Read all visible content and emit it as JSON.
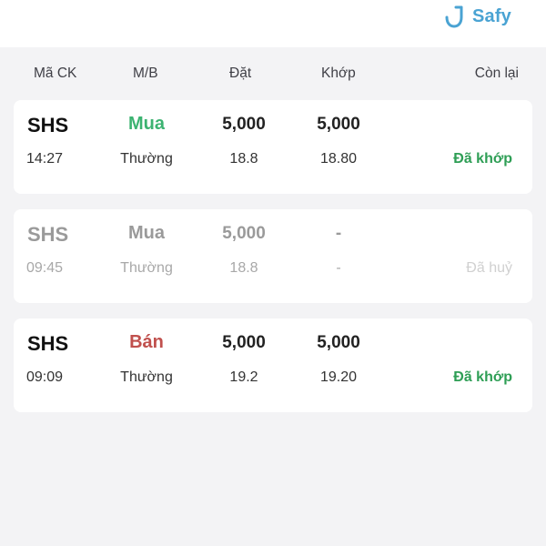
{
  "brand": {
    "name": "Safy"
  },
  "table_header": {
    "symbol": "Mã CK",
    "side": "M/B",
    "order": "Đặt",
    "matched": "Khớp",
    "remaining": "Còn lại"
  },
  "orders": [
    {
      "symbol": "SHS",
      "time": "14:27",
      "side": "Mua",
      "type": "Thường",
      "order_qty": "5,000",
      "order_price": "18.8",
      "match_qty": "5,000",
      "match_price": "18.80",
      "status": "Đã khớp"
    },
    {
      "symbol": "SHS",
      "time": "09:45",
      "side": "Mua",
      "type": "Thường",
      "order_qty": "5,000",
      "order_price": "18.8",
      "match_qty": "-",
      "match_price": "-",
      "status": "Đã huỷ"
    },
    {
      "symbol": "SHS",
      "time": "09:09",
      "side": "Bán",
      "type": "Thường",
      "order_qty": "5,000",
      "order_price": "19.2",
      "match_qty": "5,000",
      "match_price": "19.20",
      "status": "Đã khớp"
    }
  ],
  "colors": {
    "buy": "#3cb371",
    "sell": "#c0504d",
    "matched": "#2e9e55",
    "brand": "#4aa3d3"
  },
  "icons": {
    "brand": "safy-logo-icon"
  }
}
